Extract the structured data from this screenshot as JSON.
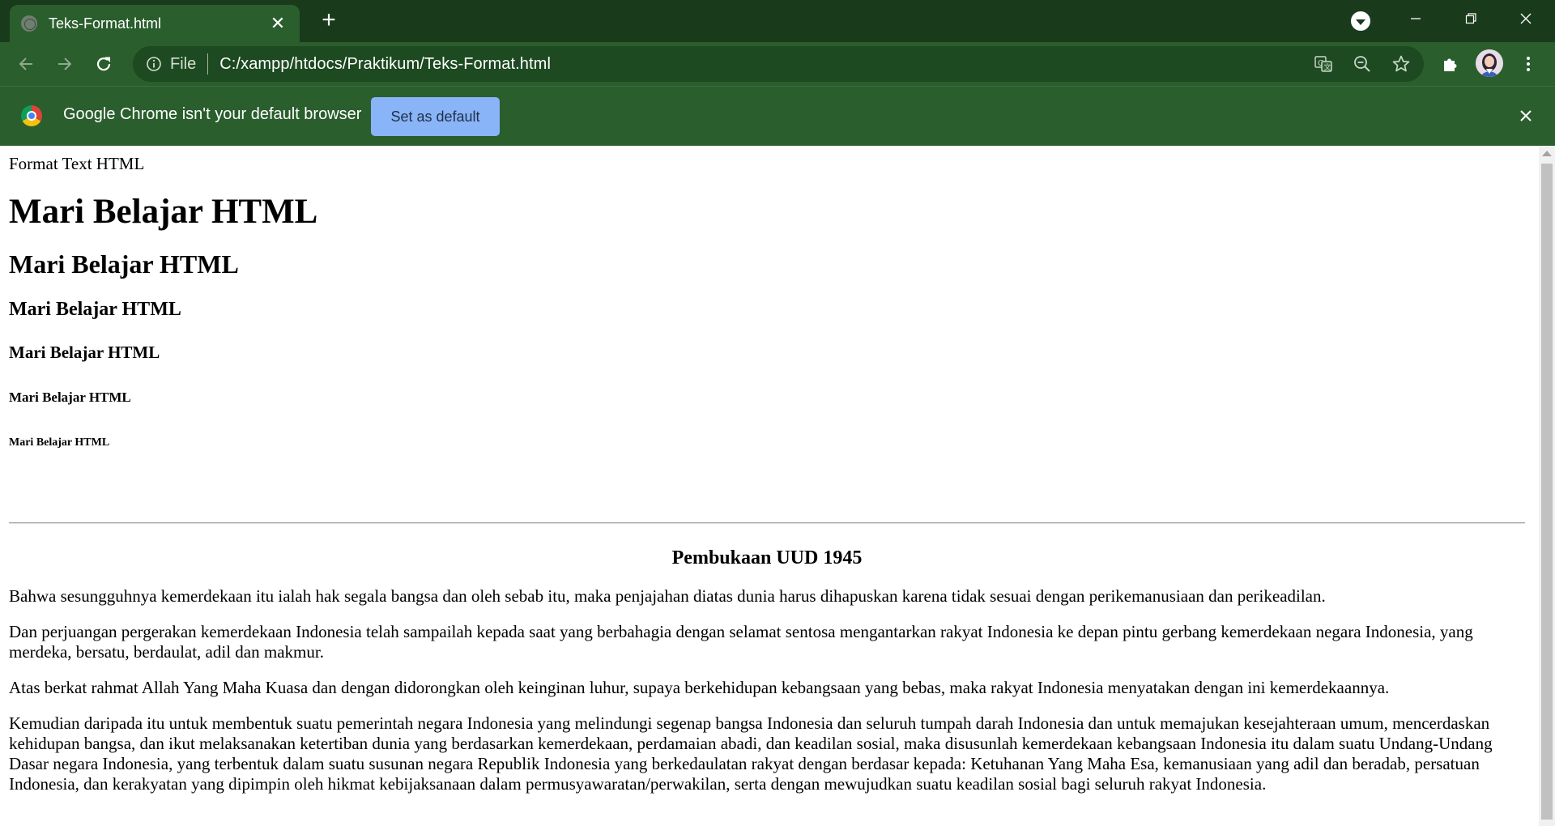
{
  "browser": {
    "tab": {
      "title": "Teks-Format.html",
      "close_glyph": "✕",
      "favicon": "globe-icon"
    },
    "new_tab_glyph": "+",
    "window_controls": {
      "minimize": "—",
      "restore": "❐",
      "close": "✕"
    },
    "address": {
      "scheme_label": "File",
      "url": "C:/xampp/htdocs/Praktikum/Teks-Format.html"
    },
    "icons": {
      "back": "arrow-left-icon",
      "forward": "arrow-right-icon",
      "reload": "reload-icon",
      "site_info": "info-icon",
      "translate": "translate-icon",
      "zoom": "zoom-out-icon",
      "bookmark": "star-icon",
      "extensions": "puzzle-icon",
      "profile": "avatar",
      "menu": "kebab-menu-icon"
    },
    "theme": {
      "frame": "#1a3a1c",
      "toolbar": "#2a5e2d",
      "omnibox": "#1d4a20",
      "button": "#8ab4f8"
    }
  },
  "infobar": {
    "message": "Google Chrome isn't your default browser",
    "button_label": "Set as default",
    "close_glyph": "✕"
  },
  "page": {
    "plain_title": "Format Text HTML",
    "headings": [
      "Mari Belajar HTML",
      "Mari Belajar HTML",
      "Mari Belajar HTML",
      "Mari Belajar HTML",
      "Mari Belajar HTML",
      "Mari Belajar HTML"
    ],
    "section_title": "Pembukaan UUD 1945",
    "paragraphs": [
      "Bahwa sesungguhnya kemerdekaan itu ialah hak segala bangsa dan oleh sebab itu, maka penjajahan diatas dunia harus dihapuskan karena tidak sesuai dengan perikemanusiaan dan perikeadilan.",
      "Dan perjuangan pergerakan kemerdekaan Indonesia telah sampailah kepada saat yang berbahagia dengan selamat sentosa mengantarkan rakyat Indonesia ke depan pintu gerbang kemerdekaan negara Indonesia, yang merdeka, bersatu, berdaulat, adil dan makmur.",
      "Atas berkat rahmat Allah Yang Maha Kuasa dan dengan didorongkan oleh keinginan luhur, supaya berkehidupan kebangsaan yang bebas, maka rakyat Indonesia menyatakan dengan ini kemerdekaannya.",
      "Kemudian daripada itu untuk membentuk suatu pemerintah negara Indonesia yang melindungi segenap bangsa Indonesia dan seluruh tumpah darah Indonesia dan untuk memajukan kesejahteraan umum, mencerdaskan kehidupan bangsa, dan ikut melaksanakan ketertiban dunia yang berdasarkan kemerdekaan, perdamaian abadi, dan keadilan sosial, maka disusunlah kemerdekaan kebangsaan Indonesia itu dalam suatu Undang-Undang Dasar negara Indonesia, yang terbentuk dalam suatu susunan negara Republik Indonesia yang berkedaulatan rakyat dengan berdasar kepada: Ketuhanan Yang Maha Esa, kemanusiaan yang adil dan beradab, persatuan Indonesia, dan kerakyatan yang dipimpin oleh hikmat kebijaksanaan dalam permusyawaratan/perwakilan, serta dengan mewujudkan suatu keadilan sosial bagi seluruh rakyat Indonesia."
    ]
  }
}
